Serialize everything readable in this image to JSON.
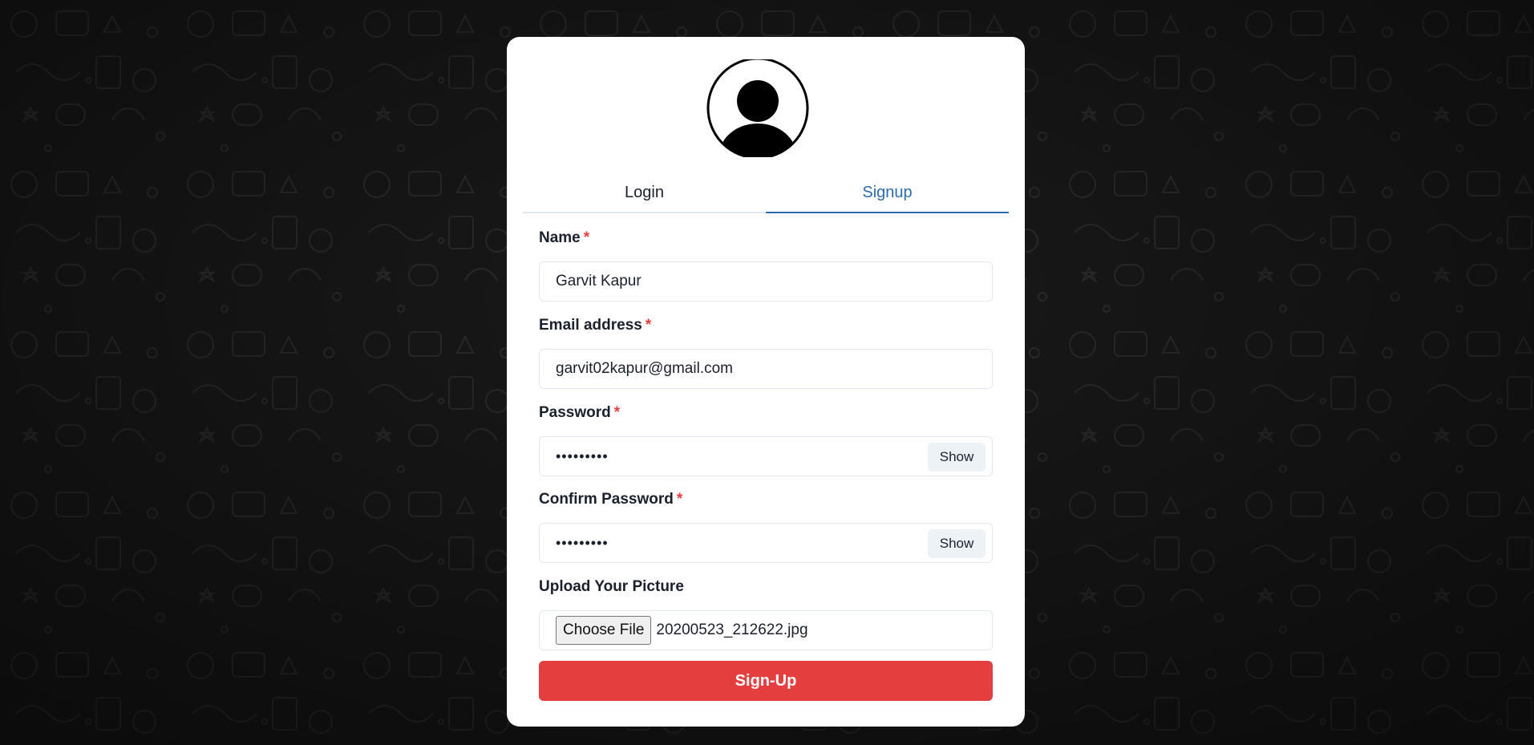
{
  "tabs": [
    {
      "label": "Login",
      "active": false
    },
    {
      "label": "Signup",
      "active": true
    }
  ],
  "form": {
    "name": {
      "label": "Name",
      "required_mark": "*",
      "value": "Garvit Kapur"
    },
    "email": {
      "label": "Email address",
      "required_mark": "*",
      "value": "garvit02kapur@gmail.com"
    },
    "password": {
      "label": "Password",
      "required_mark": "*",
      "value": "•••••••••",
      "toggle_label": "Show"
    },
    "confirm_password": {
      "label": "Confirm Password",
      "required_mark": "*",
      "value": "•••••••••",
      "toggle_label": "Show"
    },
    "picture": {
      "label": "Upload Your Picture",
      "button_label": "Choose File",
      "file_name": "20200523_212622.jpg"
    },
    "submit_label": "Sign-Up"
  },
  "avatar": {
    "icon": "user-silhouette-icon"
  },
  "colors": {
    "accent": "#2b6cb0",
    "submit": "#e53e3e",
    "required": "#e53e3e",
    "background": "#141414"
  }
}
